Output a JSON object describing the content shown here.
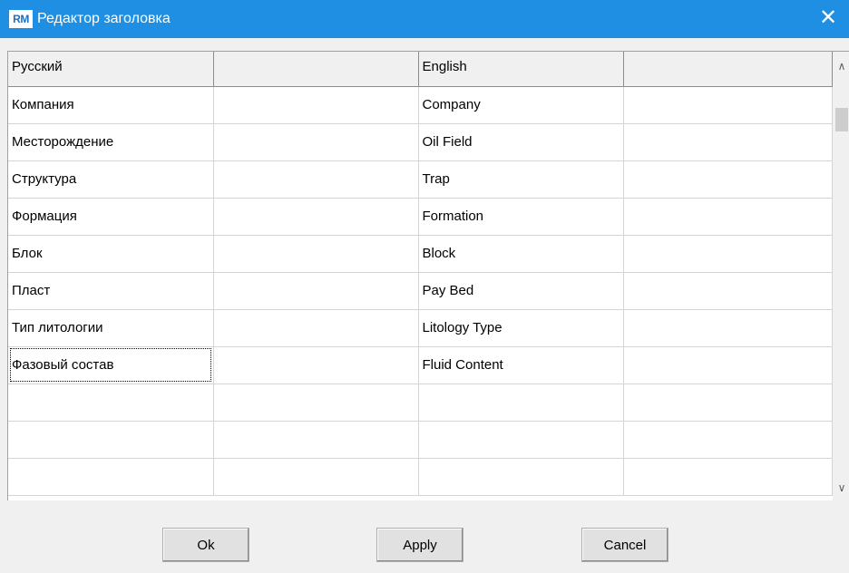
{
  "window": {
    "icon_text": "RM",
    "title": "Редактор заголовка",
    "close_symbol": "✕"
  },
  "grid": {
    "headers": [
      "Русский",
      "",
      "English",
      ""
    ],
    "rows": [
      [
        "Компания",
        "",
        "Company",
        ""
      ],
      [
        "Месторождение",
        "",
        "Oil Field",
        ""
      ],
      [
        "Структура",
        "",
        "Trap",
        ""
      ],
      [
        "Формация",
        "",
        "Formation",
        ""
      ],
      [
        "Блок",
        "",
        "Block",
        ""
      ],
      [
        "Пласт",
        "",
        "Pay Bed",
        ""
      ],
      [
        "Тип литологии",
        "",
        "Litology Type",
        ""
      ],
      [
        "Фазовый состав",
        "",
        "Fluid Content",
        ""
      ],
      [
        "",
        "",
        "",
        ""
      ],
      [
        "",
        "",
        "",
        ""
      ],
      [
        "",
        "",
        "",
        ""
      ]
    ],
    "focused_row": 7
  },
  "scrollbar": {
    "up_symbol": "∧",
    "down_symbol": "∨"
  },
  "buttons": {
    "ok_label": "Ok",
    "apply_label": "Apply",
    "cancel_label": "Cancel"
  },
  "colors": {
    "titlebar": "#1e8fe3",
    "background": "#f0f0f0"
  }
}
